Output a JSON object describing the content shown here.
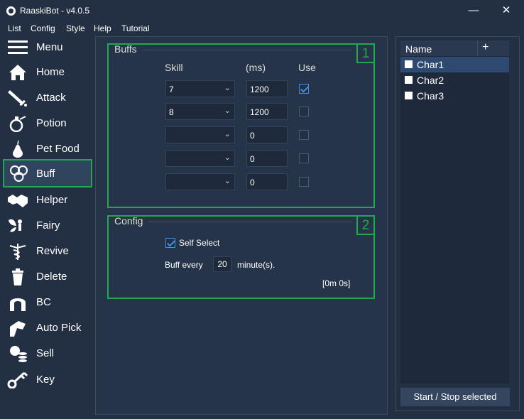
{
  "window": {
    "title": "RaaskiBot - v4.0.5",
    "minimize": "—",
    "close": "✕"
  },
  "menu": [
    "List",
    "Config",
    "Style",
    "Help",
    "Tutorial"
  ],
  "sidebar": [
    {
      "label": "Menu",
      "icon": "menu-icon"
    },
    {
      "label": "Home",
      "icon": "home-icon"
    },
    {
      "label": "Attack",
      "icon": "sword-icon"
    },
    {
      "label": "Potion",
      "icon": "potion-icon"
    },
    {
      "label": "Pet Food",
      "icon": "pear-icon"
    },
    {
      "label": "Buff",
      "icon": "swirl-icon",
      "selected": true
    },
    {
      "label": "Helper",
      "icon": "handshake-icon"
    },
    {
      "label": "Fairy",
      "icon": "fairy-icon"
    },
    {
      "label": "Revive",
      "icon": "caduceus-icon"
    },
    {
      "label": "Delete",
      "icon": "trash-icon"
    },
    {
      "label": "BC",
      "icon": "horseshoe-icon"
    },
    {
      "label": "Auto Pick",
      "icon": "pick-hand-icon"
    },
    {
      "label": "Sell",
      "icon": "money-icon"
    },
    {
      "label": "Key",
      "icon": "key-icon"
    }
  ],
  "buffs": {
    "legend": "Buffs",
    "badge": "1",
    "headers": {
      "skill": "Skill",
      "ms": "(ms)",
      "use": "Use"
    },
    "rows": [
      {
        "skill": "7",
        "ms": "1200",
        "use": true
      },
      {
        "skill": "8",
        "ms": "1200",
        "use": false
      },
      {
        "skill": "",
        "ms": "0",
        "use": false
      },
      {
        "skill": "",
        "ms": "0",
        "use": false
      },
      {
        "skill": "",
        "ms": "0",
        "use": false
      }
    ],
    "chevron": "⌄"
  },
  "config": {
    "legend": "Config",
    "badge": "2",
    "self_select_label": "Self Select",
    "self_select": true,
    "buff_every_label": "Buff every",
    "buff_every_value": "20",
    "minutes_label": "minute(s).",
    "timer": "[0m 0s]"
  },
  "characters": {
    "header": "Name",
    "add": "+",
    "items": [
      "Char1",
      "Char2",
      "Char3"
    ],
    "selected": "Char1"
  },
  "start_stop_label": "Start / Stop selected",
  "colors": {
    "background": "#233044",
    "accent_green": "#20a750",
    "check_blue": "#3c91e6",
    "selection": "#2f4a70"
  }
}
